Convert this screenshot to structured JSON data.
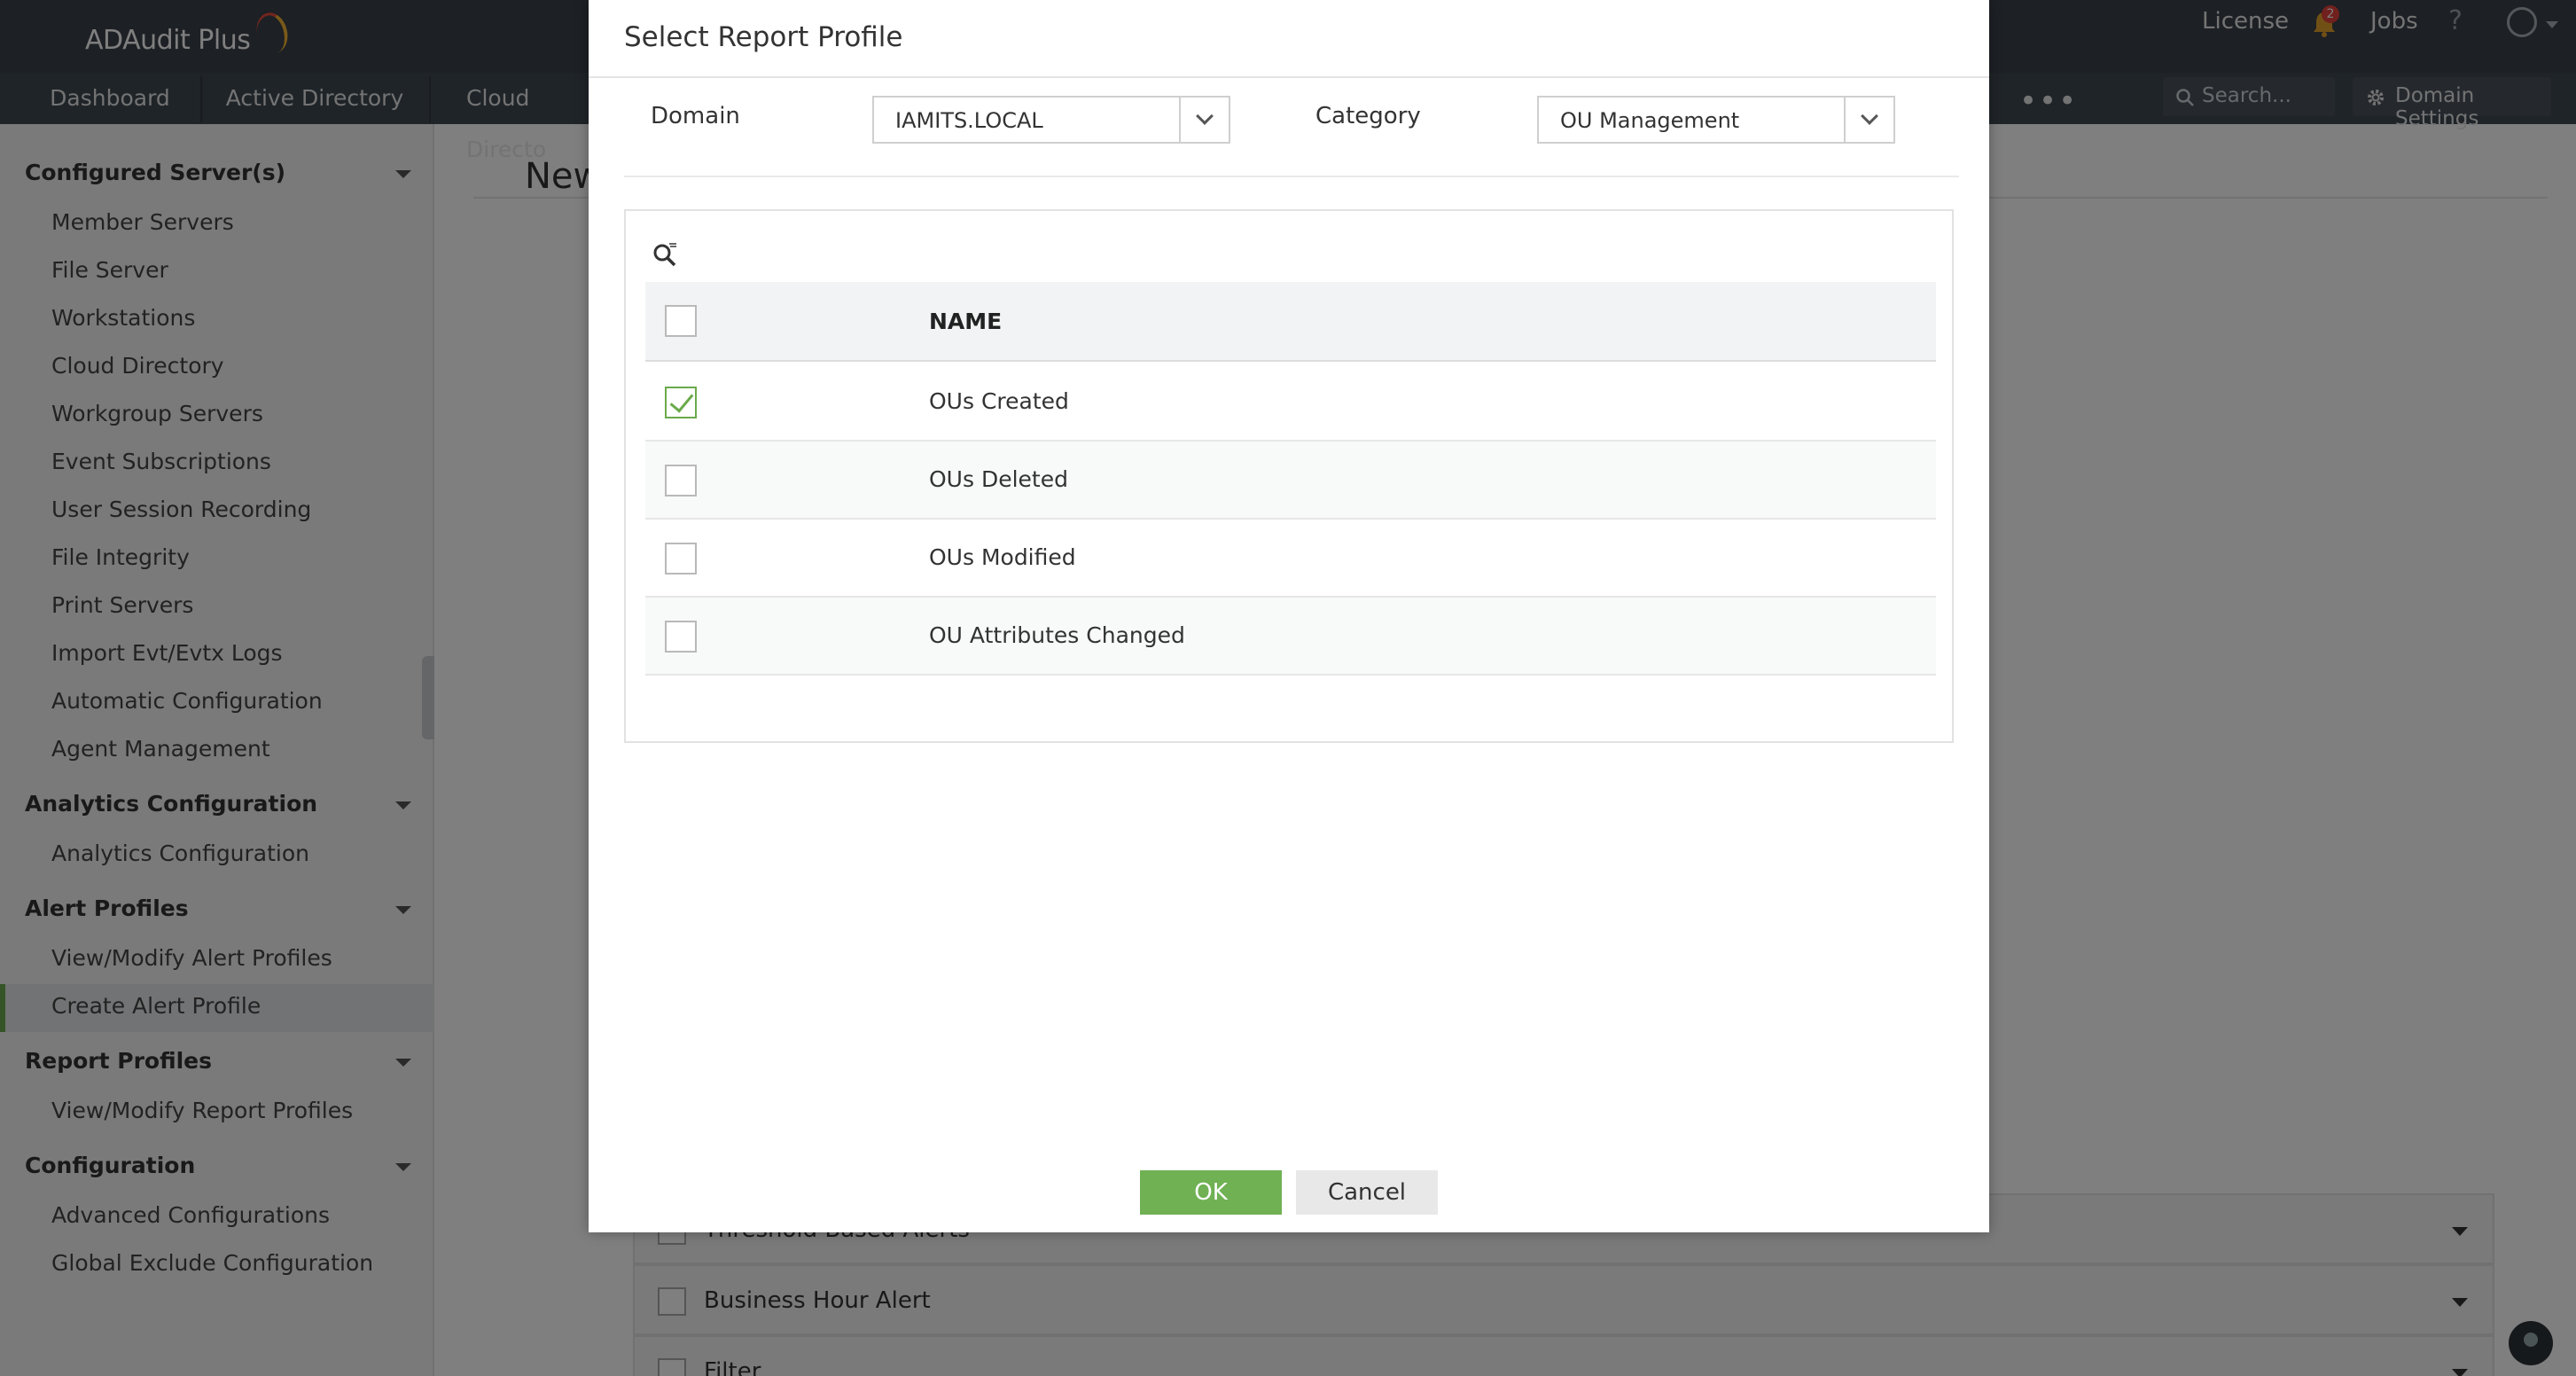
{
  "app": {
    "logo_text": "ADAudit Plus",
    "license_label": "License",
    "notification_count": "2",
    "jobs_label": "Jobs",
    "help_label": "?"
  },
  "nav": {
    "tabs": [
      "Dashboard",
      "Active Directory",
      "Cloud Directo"
    ],
    "more_label": "•••",
    "search_placeholder": "Search...",
    "domain_settings_label": "Domain Settings"
  },
  "sidebar": {
    "sections": [
      {
        "title": "Configured Server(s)",
        "items": [
          "Member Servers",
          "File Server",
          "Workstations",
          "Cloud Directory",
          "Workgroup Servers",
          "Event Subscriptions",
          "User Session Recording",
          "File Integrity",
          "Print Servers",
          "Import Evt/Evtx Logs",
          "Automatic Configuration",
          "Agent Management"
        ]
      },
      {
        "title": "Analytics Configuration",
        "items": [
          "Analytics Configuration"
        ]
      },
      {
        "title": "Alert Profiles",
        "items": [
          "View/Modify Alert Profiles",
          "Create Alert Profile"
        ]
      },
      {
        "title": "Report Profiles",
        "items": [
          "View/Modify Report Profiles"
        ]
      },
      {
        "title": "Configuration",
        "items": [
          "Advanced Configurations",
          "Global Exclude Configuration"
        ]
      }
    ],
    "active_item": "Create Alert Profile"
  },
  "page": {
    "title_partial": "New",
    "panels": [
      "Threshold Based Alerts",
      "Business Hour Alert",
      "Filter"
    ]
  },
  "modal": {
    "title": "Select Report Profile",
    "domain_label": "Domain",
    "domain_value": "IAMITS.LOCAL",
    "category_label": "Category",
    "category_value": "OU Management",
    "column_name": "NAME",
    "rows": [
      {
        "name": "OUs Created",
        "checked": true
      },
      {
        "name": "OUs Deleted",
        "checked": false
      },
      {
        "name": "OUs Modified",
        "checked": false
      },
      {
        "name": "OU Attributes Changed",
        "checked": false
      }
    ],
    "ok_label": "OK",
    "cancel_label": "Cancel"
  },
  "colors": {
    "topbar": "#3a4149",
    "accent_green": "#6fb153"
  }
}
